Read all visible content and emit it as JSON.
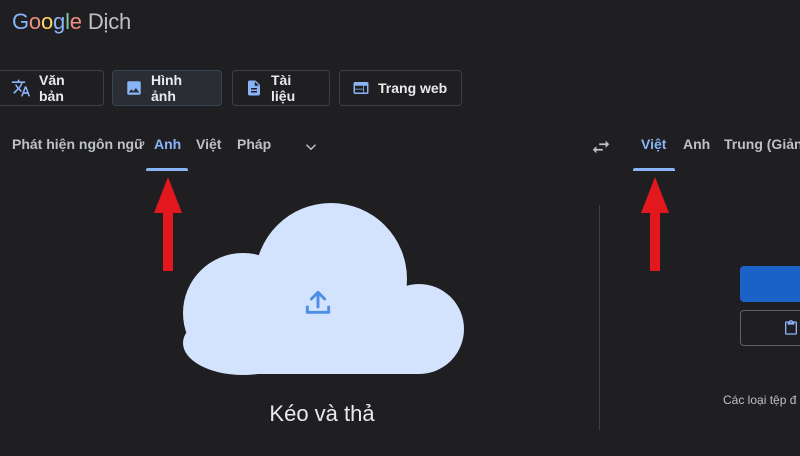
{
  "logo": {
    "brand": "Google",
    "product": "Dịch"
  },
  "mode_tabs": [
    {
      "label": "Văn bản",
      "icon": "translate-icon"
    },
    {
      "label": "Hình ảnh",
      "icon": "image-icon",
      "active": true
    },
    {
      "label": "Tài liệu",
      "icon": "document-icon"
    },
    {
      "label": "Trang web",
      "icon": "web-icon"
    }
  ],
  "source_langs": {
    "detect": "Phát hiện ngôn ngữ",
    "items": [
      "Anh",
      "Việt",
      "Pháp"
    ],
    "active": "Anh"
  },
  "target_langs": {
    "items": [
      "Việt",
      "Anh",
      "Trung (Giản"
    ],
    "active": "Việt"
  },
  "drop_zone": {
    "text": "Kéo và thả"
  },
  "right_panel": {
    "filetypes_text": "Các loại tệp đ"
  },
  "colors": {
    "accent": "#8ab4f8",
    "arrow": "#e3171e",
    "cloud": "#d3e3fd",
    "upload_icon": "#4d8fe6",
    "browse_button": "#1a62c7",
    "background": "#1f1f21"
  }
}
